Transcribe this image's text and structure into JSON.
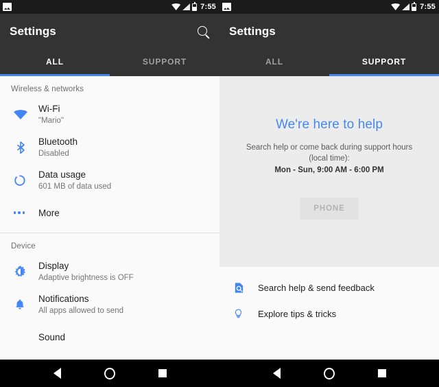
{
  "status_bar": {
    "notification_icon": "screenshot-icon",
    "wifi_icon": "wifi-icon",
    "signal_icon": "cellular-signal-icon",
    "battery_icon": "battery-icon",
    "time": "7:55"
  },
  "colors": {
    "accent_blue": "#4285f4",
    "tab_indicator": "#4688f1",
    "appbar": "#333333",
    "statusbar": "#1b1b1b",
    "panel_bg": "#fafafa",
    "support_bg": "#ececec"
  },
  "left_screen": {
    "appbar": {
      "title": "Settings",
      "search_icon": "search-icon"
    },
    "tabs": [
      {
        "label": "ALL",
        "active": true
      },
      {
        "label": "SUPPORT",
        "active": false
      }
    ],
    "sections": [
      {
        "header": "Wireless & networks",
        "items": [
          {
            "icon": "wifi-icon",
            "title": "Wi-Fi",
            "subtitle": "\"Mario\""
          },
          {
            "icon": "bluetooth-icon",
            "title": "Bluetooth",
            "subtitle": "Disabled"
          },
          {
            "icon": "data-usage-icon",
            "title": "Data usage",
            "subtitle": "601 MB of data used"
          },
          {
            "icon": "more-icon",
            "title": "More",
            "subtitle": ""
          }
        ]
      },
      {
        "header": "Device",
        "items": [
          {
            "icon": "brightness-icon",
            "title": "Display",
            "subtitle": "Adaptive brightness is OFF"
          },
          {
            "icon": "bell-icon",
            "title": "Notifications",
            "subtitle": "All apps allowed to send"
          },
          {
            "icon": "sound-icon",
            "title": "Sound",
            "subtitle": ""
          }
        ]
      }
    ]
  },
  "right_screen": {
    "appbar": {
      "title": "Settings"
    },
    "tabs": [
      {
        "label": "ALL",
        "active": false
      },
      {
        "label": "SUPPORT",
        "active": true
      }
    ],
    "hero": {
      "title": "We're here to help",
      "subtitle": "Search help or come back during support hours (local time):",
      "hours": "Mon - Sun, 9:00 AM - 6:00 PM",
      "phone_button": "PHONE"
    },
    "links": [
      {
        "icon": "help-search-icon",
        "label": "Search help & send feedback"
      },
      {
        "icon": "lightbulb-icon",
        "label": "Explore tips & tricks"
      }
    ]
  },
  "nav_bar": {
    "back": "back-icon",
    "home": "home-icon",
    "recents": "recents-icon"
  }
}
